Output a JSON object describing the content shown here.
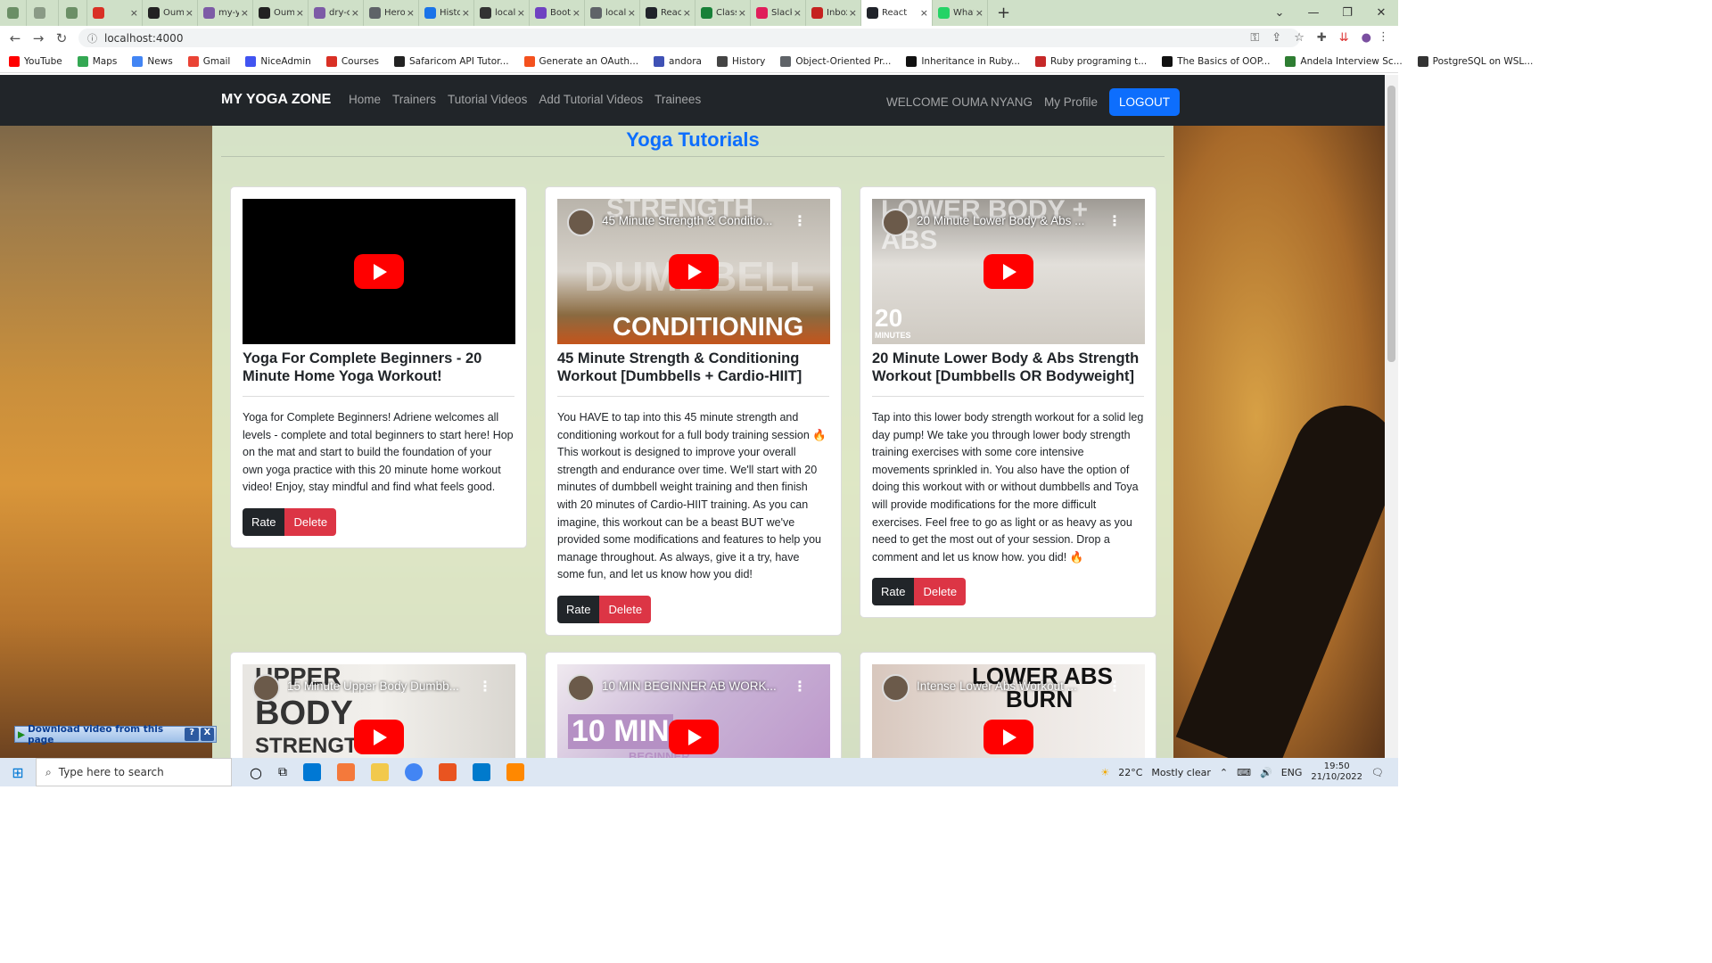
{
  "browser": {
    "tabs": [
      {
        "title": "",
        "color": "#6b8f66"
      },
      {
        "title": "",
        "color": "#8a9a86"
      },
      {
        "title": "",
        "color": "#6b8f66"
      },
      {
        "title": "",
        "color": "#d93025"
      },
      {
        "title": "Ouma",
        "color": "#222222"
      },
      {
        "title": "my-yo",
        "color": "#7d5ba6"
      },
      {
        "title": "Ouma",
        "color": "#222222"
      },
      {
        "title": "dry-co",
        "color": "#7d5ba6"
      },
      {
        "title": "Herok",
        "color": "#5f6368"
      },
      {
        "title": "Histor",
        "color": "#1a73e8"
      },
      {
        "title": "localh",
        "color": "#333333"
      },
      {
        "title": "Boots",
        "color": "#6f42c1"
      },
      {
        "title": "localh",
        "color": "#5f6368"
      },
      {
        "title": "React",
        "color": "#20232a"
      },
      {
        "title": "Classr",
        "color": "#188038"
      },
      {
        "title": "Slack",
        "color": "#e01e5a"
      },
      {
        "title": "Inbox",
        "color": "#c5221f"
      },
      {
        "title": "React",
        "color": "#20232a"
      },
      {
        "title": "Whats",
        "color": "#25d366"
      }
    ],
    "url": "localhost:4000",
    "bookmarks": [
      {
        "label": "YouTube",
        "color": "#ff0000"
      },
      {
        "label": "Maps",
        "color": "#34a853"
      },
      {
        "label": "News",
        "color": "#4285f4"
      },
      {
        "label": "Gmail",
        "color": "#ea4335"
      },
      {
        "label": "NiceAdmin",
        "color": "#4154f1"
      },
      {
        "label": "Courses",
        "color": "#d93025"
      },
      {
        "label": "Safaricom API Tutor...",
        "color": "#222222"
      },
      {
        "label": "Generate an OAuth...",
        "color": "#f4511e"
      },
      {
        "label": "andora",
        "color": "#3f51b5"
      },
      {
        "label": "History",
        "color": "#444444"
      },
      {
        "label": "Object-Oriented Pr...",
        "color": "#5f6368"
      },
      {
        "label": "Inheritance in Ruby...",
        "color": "#111111"
      },
      {
        "label": "Ruby programing t...",
        "color": "#c62828"
      },
      {
        "label": "The Basics of OOP...",
        "color": "#111111"
      },
      {
        "label": "Andela Interview Sc...",
        "color": "#2e7d32"
      },
      {
        "label": "PostgreSQL on WSL...",
        "color": "#333333"
      }
    ]
  },
  "navbar": {
    "brand": "MY YOGA ZONE",
    "links": [
      "Home",
      "Trainers",
      "Tutorial Videos",
      "Add Tutorial Videos",
      "Trainees"
    ],
    "welcome": "WELCOME OUMA NYANG",
    "profile": "My Profile",
    "logout": "LOGOUT"
  },
  "main": {
    "title": "Yoga Tutorials",
    "cards": [
      {
        "video_title": "",
        "title": "Yoga For Complete Beginners - 20 Minute Home Yoga Workout!",
        "description": "Yoga for Complete Beginners! Adriene welcomes all levels - complete and total beginners to start here! Hop on the mat and start to build the foundation of your own yoga practice with this 20 minute home workout video! Enjoy, stay mindful and find what feels good.",
        "rate": "Rate",
        "delete": "Delete"
      },
      {
        "video_title": "45 Minute Strength & Conditio...",
        "overlay_top": "STRENGTH",
        "overlay_mid": "DUMBBELL",
        "overlay_bottom": "CONDITIONING",
        "title": "45 Minute Strength & Conditioning Workout [Dumbbells + Cardio-HIIT]",
        "description": "You HAVE to tap into this 45 minute strength and conditioning workout for a full body training session 🔥 This workout is designed to improve your overall strength and endurance over time. We'll start with 20 minutes of dumbbell weight training and then finish with 20 minutes of Cardio-HIIT training. As you can imagine, this workout can be a beast BUT we've provided some modifications and features to help you manage throughout. As always, give it a try, have some fun, and let us know how you did!",
        "rate": "Rate",
        "delete": "Delete"
      },
      {
        "video_title": "20 Minute Lower Body & Abs ...",
        "overlay_top": "LOWER BODY + ABS",
        "badge_num": "20",
        "badge_unit": "MINUTES",
        "title": "20 Minute Lower Body & Abs Strength Workout [Dumbbells OR Bodyweight]",
        "description": "Tap into this lower body strength workout for a solid leg day pump! We take you through lower body strength training exercises with some core intensive movements sprinkled in. You also have the option of doing this workout with or without dumbbells and Toya will provide modifications for the more difficult exercises. Feel free to go as light or as heavy as you need to get the most out of your session. Drop a comment and let us know how. you did! 🔥",
        "rate": "Rate",
        "delete": "Delete"
      },
      {
        "video_title": "15 Minute Upper Body Dumbb...",
        "overlay_top": "UPPER",
        "overlay_mid": "BODY",
        "overlay_bottom": "STRENGTH"
      },
      {
        "video_title": "10 MIN BEGINNER AB WORK...",
        "overlay_mid": "10 MIN",
        "overlay_bottom": "BEGINNER"
      },
      {
        "video_title": "Intense Lower Abs Workout ...",
        "overlay_top": "LOWER ABS",
        "overlay_mid": "BURN"
      }
    ]
  },
  "extension": {
    "download_label": "Download video from this page",
    "help": "?",
    "close": "X"
  },
  "taskbar": {
    "search_placeholder": "Type here to search",
    "temperature": "22°C",
    "weather": "Mostly clear",
    "lang": "ENG",
    "time": "19:50",
    "date": "21/10/2022"
  }
}
